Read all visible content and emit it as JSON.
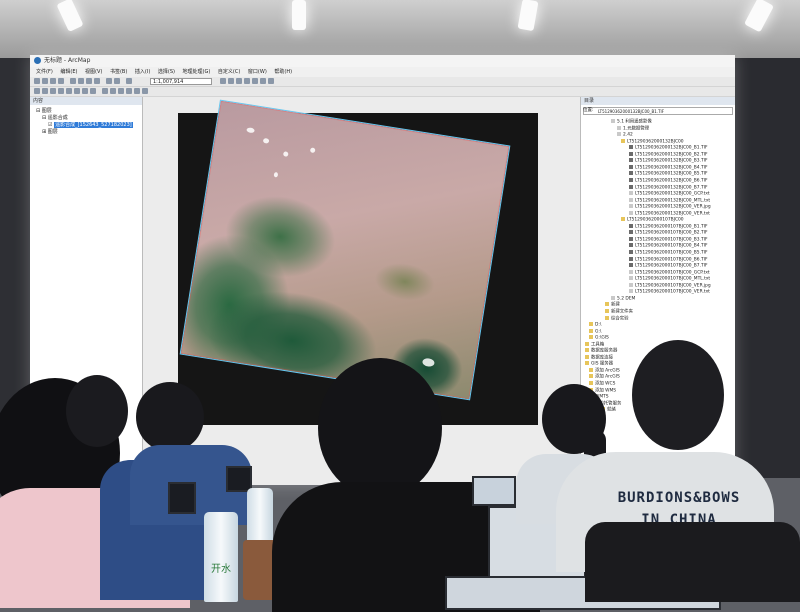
{
  "app": {
    "title": "无标题 - ArcMap",
    "menu": [
      "文件(F)",
      "编辑(E)",
      "视图(V)",
      "书签(B)",
      "插入(I)",
      "选择(S)",
      "地理处理(G)",
      "自定义(C)",
      "窗口(W)",
      "帮助(H)"
    ],
    "scale": "1:1,007,914"
  },
  "toc": {
    "title": "内容",
    "rows": [
      "图层",
      "遥影合成",
      "遥影合成_[152643_527182023]",
      "图层"
    ]
  },
  "catalog": {
    "title": "目录",
    "location_label": "位置:",
    "location": "LT51290362000132BJC00_B1.TIF",
    "rows": [
      "5.1 利用遥感影像",
      "1.元数据管理",
      "2.42",
      "LT51290362000132BJC00",
      "LT51290362000132BJC00_B1.TIF",
      "LT51290362000132BJC00_B2.TIF",
      "LT51290362000132BJC00_B3.TIF",
      "LT51290362000132BJC00_B4.TIF",
      "LT51290362000132BJC00_B5.TIF",
      "LT51290362000132BJC00_B6.TIF",
      "LT51290362000132BJC00_B7.TIF",
      "LT51290362000132BJC00_GCP.txt",
      "LT51290362000132BJC00_MTL.txt",
      "LT51290362000132BJC00_VER.jpg",
      "LT51290362000132BJC00_VER.txt",
      "LT51290362000107BJC00",
      "LT51290362000107BJC00_B1.TIF",
      "LT51290362000107BJC00_B2.TIF",
      "LT51290362000107BJC00_B3.TIF",
      "LT51290362000107BJC00_B4.TIF",
      "LT51290362000107BJC00_B5.TIF",
      "LT51290362000107BJC00_B6.TIF",
      "LT51290362000107BJC00_B7.TIF",
      "LT51290362000107BJC00_GCP.txt",
      "LT51290362000107BJC00_MTL.txt",
      "LT51290362000107BJC00_VER.jpg",
      "LT51290362000107BJC00_VER.txt",
      "5.2 DEM",
      "新建",
      "新建文件夹",
      "综合实验",
      "D:\\",
      "G:\\",
      "G:\\GIS",
      "工具箱",
      "数据库服务器",
      "数据库连接",
      "GIS 服务器",
      "添加 ArcGIS",
      "添加 ArcGIS",
      "添加 WCS",
      "添加 WMS",
      "WMTS",
      "我的托管服务",
      "就绪"
    ]
  },
  "scene": {
    "shirt_text_1": "BURDIONS&BOWS",
    "shirt_text_2": "IN CHINA",
    "bottle_label": "开水"
  },
  "colors": {
    "tree_highlight": "#2f7bd8",
    "scene_border": "#67c7ef",
    "screen_bg": "#ececec"
  }
}
